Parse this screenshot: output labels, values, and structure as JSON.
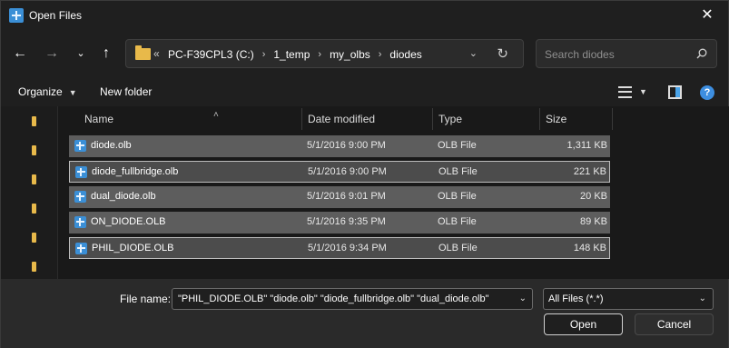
{
  "window": {
    "title": "Open Files",
    "close_icon": "close-icon"
  },
  "nav": {
    "back_icon": "arrow-left-icon",
    "forward_icon": "arrow-right-icon",
    "recent_icon": "chevron-down-icon",
    "up_icon": "arrow-up-icon"
  },
  "address": {
    "overflow": "«",
    "crumbs": [
      "PC-F39CPL3 (C:)",
      "1_temp",
      "my_olbs",
      "diodes"
    ],
    "separator": "›"
  },
  "search": {
    "placeholder": "Search diodes"
  },
  "toolbar": {
    "organize": "Organize",
    "new_folder": "New folder",
    "help": "?"
  },
  "columns": {
    "name": "Name",
    "date": "Date modified",
    "type": "Type",
    "size": "Size"
  },
  "files": [
    {
      "name": "diode.olb",
      "date": "5/1/2016 9:00 PM",
      "type": "OLB File",
      "size": "1,311 KB"
    },
    {
      "name": "diode_fullbridge.olb",
      "date": "5/1/2016 9:00 PM",
      "type": "OLB File",
      "size": "221 KB"
    },
    {
      "name": "dual_diode.olb",
      "date": "5/1/2016 9:01 PM",
      "type": "OLB File",
      "size": "20 KB"
    },
    {
      "name": "ON_DIODE.OLB",
      "date": "5/1/2016 9:35 PM",
      "type": "OLB File",
      "size": "89 KB"
    },
    {
      "name": "PHIL_DIODE.OLB",
      "date": "5/1/2016 9:34 PM",
      "type": "OLB File",
      "size": "148 KB"
    }
  ],
  "footer": {
    "file_name_label": "File name:",
    "file_name_value": "\"PHIL_DIODE.OLB\" \"diode.olb\" \"diode_fullbridge.olb\" \"dual_diode.olb\"",
    "filter_value": "All Files (*.*)",
    "open_label": "Open",
    "cancel_label": "Cancel"
  },
  "colors": {
    "accent": "#3d8ee0",
    "folder": "#e8b94a",
    "selection": "#5d5d5d"
  }
}
